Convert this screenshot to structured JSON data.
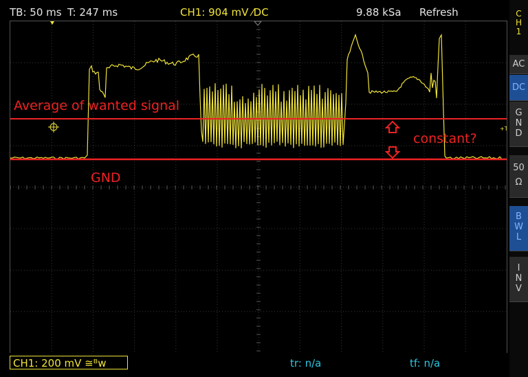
{
  "status_bar": {
    "timebase": "TB: 50 ms",
    "trigger_time": "T: 247 ms",
    "channel": "CH1: 904 mV ⁄DC",
    "sample_rate": "9.88 kSa",
    "mode": "Refresh"
  },
  "annotations": {
    "average_label": "Average of wanted signal",
    "constant_label": "constant?",
    "gnd_label": "GND",
    "trigger_marker": "+T-",
    "ch1_marker": "1"
  },
  "bottom_bar": {
    "ch1_scale": "CH1: 200 mV ≅ᴮw",
    "rise_time": "tr: n/a",
    "fall_time": "tf: n/a"
  },
  "side_panel": {
    "channel_tag": [
      "C",
      "H",
      "1"
    ],
    "buttons": [
      {
        "lines": [
          "AC"
        ],
        "active": false
      },
      {
        "lines": [
          "DC"
        ],
        "active": true
      },
      {
        "lines": [
          "G",
          "N",
          "D"
        ],
        "active": false
      },
      {
        "lines": [
          "50",
          "Ω"
        ],
        "active": false
      },
      {
        "lines": [
          "B",
          "W",
          "L"
        ],
        "active": true
      },
      {
        "lines": [
          "I",
          "N",
          "V"
        ],
        "active": false
      }
    ]
  },
  "colors": {
    "trace": "#f1e43a",
    "annotation": "#ee2222",
    "info": "#2cc5e0",
    "active_button": "#1e4f95"
  }
}
